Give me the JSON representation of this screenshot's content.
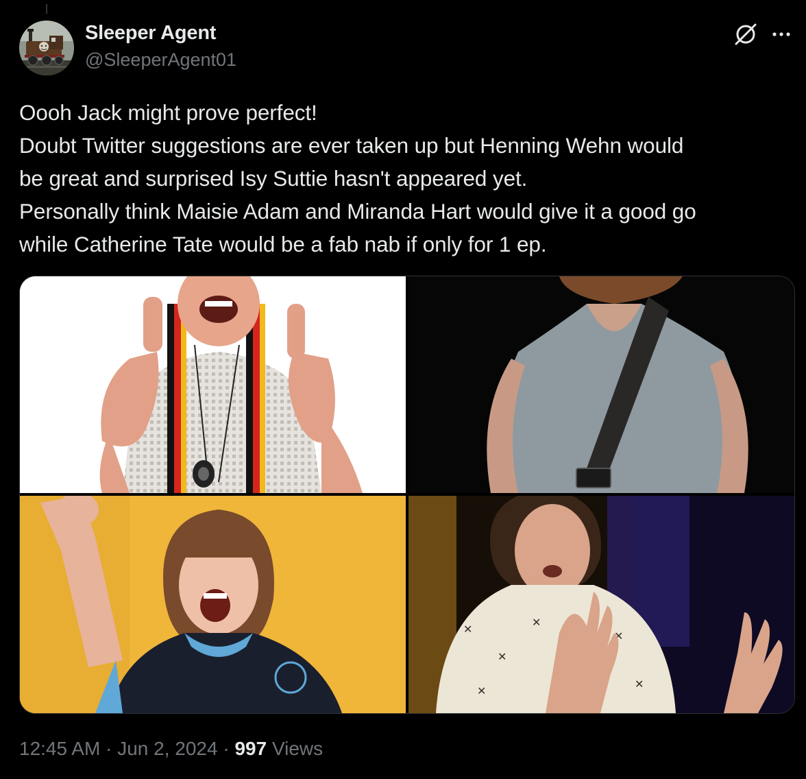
{
  "tweet": {
    "author_name": "Sleeper Agent",
    "author_handle": "@SleeperAgent01",
    "text_lines": [
      "Oooh Jack might prove perfect!",
      "Doubt Twitter suggestions are ever taken up but Henning Wehn would",
      "be great and surprised Isy Suttie hasn't appeared yet.",
      "Personally think Maisie Adam and Miranda Hart would give it a good go",
      "while Catherine Tate would be a fab nab if only for 1 ep."
    ],
    "time": "12:45 AM",
    "separator": "·",
    "date": "Jun 2, 2024",
    "views_count": "997",
    "views_label": "Views"
  },
  "icons": {
    "grok": "grok-icon",
    "more": "more-options-icon",
    "avatar": "train-avatar"
  },
  "colors": {
    "background": "#000000",
    "primary_text": "#e7e9ea",
    "secondary_text": "#71767b",
    "border": "#2f3336"
  }
}
